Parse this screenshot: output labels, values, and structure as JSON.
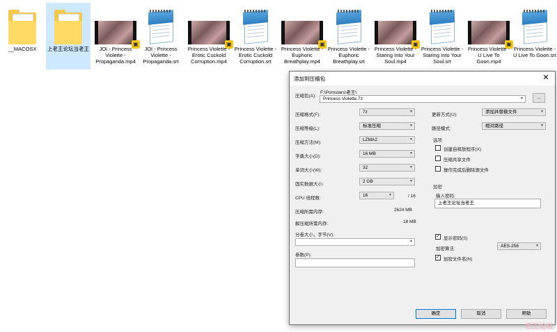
{
  "files": [
    {
      "label": "__MACOSX",
      "kind": "folder"
    },
    {
      "label": "上老王论坛当老王",
      "kind": "folder"
    },
    {
      "label": "JOI - Princess Violette - Propaganda.mp4",
      "kind": "video"
    },
    {
      "label": "JOI - Princess Violette - Propaganda.srt",
      "kind": "text"
    },
    {
      "label": "Princess Violette - Erotic Cuckold Corruption.mp4",
      "kind": "video"
    },
    {
      "label": "Princess Violette - Erotic Cuckold Corruption.srt",
      "kind": "text"
    },
    {
      "label": "Princess Violette - Euphoric Breathplay.mp4",
      "kind": "video"
    },
    {
      "label": "Princess Violette - Euphoric Breathplay.srt",
      "kind": "text"
    },
    {
      "label": "Princess Violette - Staring Into Your Soul.mp4",
      "kind": "video"
    },
    {
      "label": "Princess Violette - Staring Into Your Soul.srt",
      "kind": "text"
    },
    {
      "label": "Princess Violette - U Live To Goon.mp4",
      "kind": "video"
    },
    {
      "label": "Princess Violette - U Live To Goon.srt",
      "kind": "text"
    }
  ],
  "dialog": {
    "title": "添加到压缩包",
    "close": "✕",
    "archive_label": "压缩包(A):",
    "archive_path": "F:\\Pornstars\\老王\\",
    "archive_name": "Princess Violette.7z",
    "browse": "...",
    "format_label": "压缩格式(F):",
    "format_value": "7z",
    "level_label": "压缩等级(L):",
    "level_value": "标准压缩",
    "method_label": "压缩方法(M):",
    "method_value": "LZMA2",
    "dict_label": "字典大小(D):",
    "dict_value": "16 MB",
    "word_label": "单词大小(W):",
    "word_value": "32",
    "solid_label": "固实数据大小:",
    "solid_value": "2 GB",
    "cpu_label": "CPU 线程数:",
    "cpu_value": "16",
    "cpu_total": "/ 16",
    "mem_comp_label": "压缩所需内存:",
    "mem_comp_value": "2624 MB",
    "mem_decomp_label": "解压缩所需内存:",
    "mem_decomp_value": "18 MB",
    "split_label": "分卷大小，字节(V):",
    "params_label": "参数(P):",
    "update_label": "更新方式(U):",
    "update_value": "添加并替换文件",
    "pathmode_label": "路径模式:",
    "pathmode_value": "相对路径",
    "options_title": "选项",
    "opt_sfx": "创建自释放程序(X)",
    "opt_shared": "压缩共享文件",
    "opt_delete": "操作完成后删除源文件",
    "encrypt_title": "加密",
    "password_label": "输入密码:",
    "password_value": "上老王论坛当老王",
    "show_password": "显示密码(S)",
    "enc_method_label": "加密算法:",
    "enc_method_value": "AES-256",
    "encrypt_names": "加密文件名(N)",
    "ok": "确定",
    "cancel": "取消",
    "help": "帮助"
  },
  "icons": {
    "check": "✓",
    "dropdown": "▾",
    "badge": "▣"
  },
  "watermark": "老王论坛"
}
